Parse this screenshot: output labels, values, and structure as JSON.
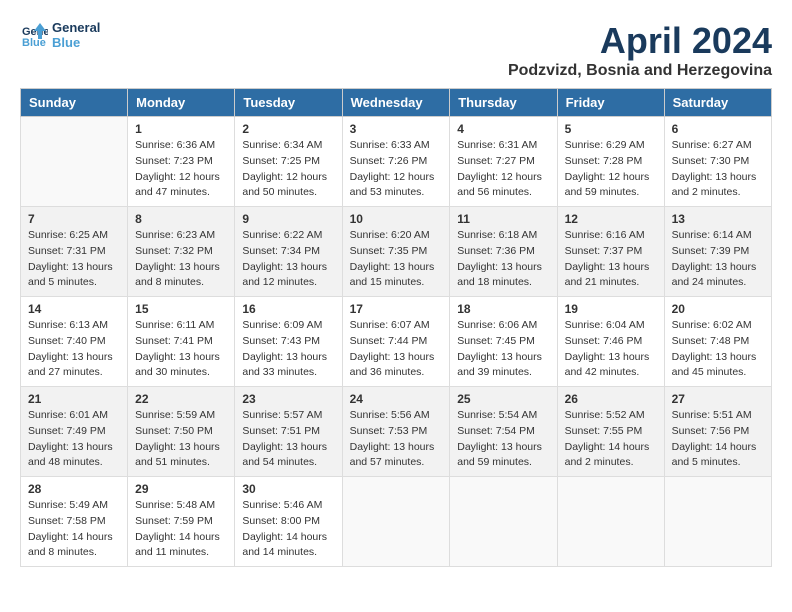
{
  "logo": {
    "line1": "General",
    "line2": "Blue"
  },
  "title": "April 2024",
  "location": "Podzvizd, Bosnia and Herzegovina",
  "weekdays": [
    "Sunday",
    "Monday",
    "Tuesday",
    "Wednesday",
    "Thursday",
    "Friday",
    "Saturday"
  ],
  "weeks": [
    [
      {
        "day": "",
        "info": ""
      },
      {
        "day": "1",
        "info": "Sunrise: 6:36 AM\nSunset: 7:23 PM\nDaylight: 12 hours\nand 47 minutes."
      },
      {
        "day": "2",
        "info": "Sunrise: 6:34 AM\nSunset: 7:25 PM\nDaylight: 12 hours\nand 50 minutes."
      },
      {
        "day": "3",
        "info": "Sunrise: 6:33 AM\nSunset: 7:26 PM\nDaylight: 12 hours\nand 53 minutes."
      },
      {
        "day": "4",
        "info": "Sunrise: 6:31 AM\nSunset: 7:27 PM\nDaylight: 12 hours\nand 56 minutes."
      },
      {
        "day": "5",
        "info": "Sunrise: 6:29 AM\nSunset: 7:28 PM\nDaylight: 12 hours\nand 59 minutes."
      },
      {
        "day": "6",
        "info": "Sunrise: 6:27 AM\nSunset: 7:30 PM\nDaylight: 13 hours\nand 2 minutes."
      }
    ],
    [
      {
        "day": "7",
        "info": "Sunrise: 6:25 AM\nSunset: 7:31 PM\nDaylight: 13 hours\nand 5 minutes."
      },
      {
        "day": "8",
        "info": "Sunrise: 6:23 AM\nSunset: 7:32 PM\nDaylight: 13 hours\nand 8 minutes."
      },
      {
        "day": "9",
        "info": "Sunrise: 6:22 AM\nSunset: 7:34 PM\nDaylight: 13 hours\nand 12 minutes."
      },
      {
        "day": "10",
        "info": "Sunrise: 6:20 AM\nSunset: 7:35 PM\nDaylight: 13 hours\nand 15 minutes."
      },
      {
        "day": "11",
        "info": "Sunrise: 6:18 AM\nSunset: 7:36 PM\nDaylight: 13 hours\nand 18 minutes."
      },
      {
        "day": "12",
        "info": "Sunrise: 6:16 AM\nSunset: 7:37 PM\nDaylight: 13 hours\nand 21 minutes."
      },
      {
        "day": "13",
        "info": "Sunrise: 6:14 AM\nSunset: 7:39 PM\nDaylight: 13 hours\nand 24 minutes."
      }
    ],
    [
      {
        "day": "14",
        "info": "Sunrise: 6:13 AM\nSunset: 7:40 PM\nDaylight: 13 hours\nand 27 minutes."
      },
      {
        "day": "15",
        "info": "Sunrise: 6:11 AM\nSunset: 7:41 PM\nDaylight: 13 hours\nand 30 minutes."
      },
      {
        "day": "16",
        "info": "Sunrise: 6:09 AM\nSunset: 7:43 PM\nDaylight: 13 hours\nand 33 minutes."
      },
      {
        "day": "17",
        "info": "Sunrise: 6:07 AM\nSunset: 7:44 PM\nDaylight: 13 hours\nand 36 minutes."
      },
      {
        "day": "18",
        "info": "Sunrise: 6:06 AM\nSunset: 7:45 PM\nDaylight: 13 hours\nand 39 minutes."
      },
      {
        "day": "19",
        "info": "Sunrise: 6:04 AM\nSunset: 7:46 PM\nDaylight: 13 hours\nand 42 minutes."
      },
      {
        "day": "20",
        "info": "Sunrise: 6:02 AM\nSunset: 7:48 PM\nDaylight: 13 hours\nand 45 minutes."
      }
    ],
    [
      {
        "day": "21",
        "info": "Sunrise: 6:01 AM\nSunset: 7:49 PM\nDaylight: 13 hours\nand 48 minutes."
      },
      {
        "day": "22",
        "info": "Sunrise: 5:59 AM\nSunset: 7:50 PM\nDaylight: 13 hours\nand 51 minutes."
      },
      {
        "day": "23",
        "info": "Sunrise: 5:57 AM\nSunset: 7:51 PM\nDaylight: 13 hours\nand 54 minutes."
      },
      {
        "day": "24",
        "info": "Sunrise: 5:56 AM\nSunset: 7:53 PM\nDaylight: 13 hours\nand 57 minutes."
      },
      {
        "day": "25",
        "info": "Sunrise: 5:54 AM\nSunset: 7:54 PM\nDaylight: 13 hours\nand 59 minutes."
      },
      {
        "day": "26",
        "info": "Sunrise: 5:52 AM\nSunset: 7:55 PM\nDaylight: 14 hours\nand 2 minutes."
      },
      {
        "day": "27",
        "info": "Sunrise: 5:51 AM\nSunset: 7:56 PM\nDaylight: 14 hours\nand 5 minutes."
      }
    ],
    [
      {
        "day": "28",
        "info": "Sunrise: 5:49 AM\nSunset: 7:58 PM\nDaylight: 14 hours\nand 8 minutes."
      },
      {
        "day": "29",
        "info": "Sunrise: 5:48 AM\nSunset: 7:59 PM\nDaylight: 14 hours\nand 11 minutes."
      },
      {
        "day": "30",
        "info": "Sunrise: 5:46 AM\nSunset: 8:00 PM\nDaylight: 14 hours\nand 14 minutes."
      },
      {
        "day": "",
        "info": ""
      },
      {
        "day": "",
        "info": ""
      },
      {
        "day": "",
        "info": ""
      },
      {
        "day": "",
        "info": ""
      }
    ]
  ]
}
